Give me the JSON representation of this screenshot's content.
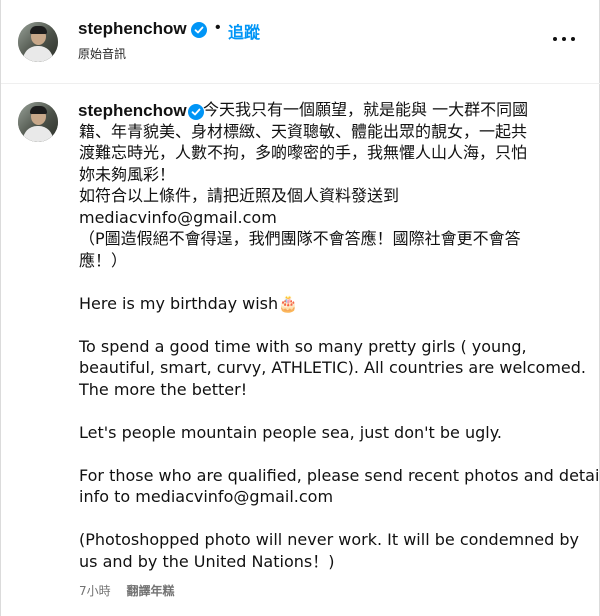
{
  "header": {
    "username": "stephenchow",
    "dot": "•",
    "follow_label": "追蹤",
    "audio_label": "原始音訊",
    "more_icon": "more-horizontal-icon"
  },
  "post": {
    "username": "stephenchow",
    "caption_lines": [
      "今天我只有一個願望，就是能與 一大群不同國",
      "籍、年青貌美、身材標緻、天資聰敏、體能出眾的靚女，一起共",
      "渡難忘時光，人數不拘，多啲嚟密的手，我無懼人山人海，只怕",
      "妳未夠風彩！",
      "如符合以上條件，請把近照及個人資料發送到",
      "mediacvinfo@gmail.com",
      "（P圖造假絕不會得逞，我們團隊不會答應！國際社會更不會答",
      "應！）",
      "",
      "Here is my birthday wish🎂",
      "",
      "To spend a good time with so many pretty girls ( young,",
      "beautiful, smart, curvy, ATHLETIC). All countries are welcomed.",
      "The more the better!",
      "",
      "Let's people mountain people sea, just don't be ugly.",
      "",
      "For those who are qualified, please send recent photos and detail",
      "info to mediacvinfo@gmail.com",
      "",
      "(Photoshopped photo will never work. It will be condemned by",
      "us and by the United Nations！)"
    ],
    "time_label": "7小時",
    "translate_label": "翻譯年糕"
  },
  "colors": {
    "accent": "#0095f6",
    "verified": "#0095f6",
    "muted_text": "#737373",
    "divider": "#efefef"
  }
}
